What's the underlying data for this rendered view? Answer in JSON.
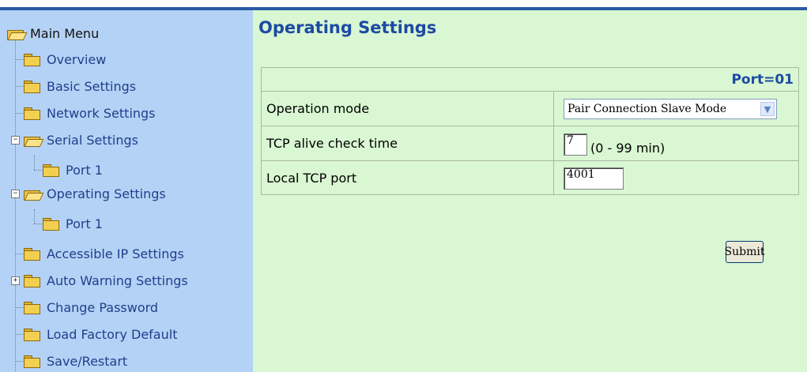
{
  "sidebar": {
    "root_label": "Main Menu",
    "items": [
      {
        "label": "Overview"
      },
      {
        "label": "Basic Settings"
      },
      {
        "label": "Network Settings"
      },
      {
        "label": "Serial Settings",
        "expander": "−"
      },
      {
        "label": "Port 1"
      },
      {
        "label": "Operating Settings",
        "expander": "−"
      },
      {
        "label": "Port 1"
      },
      {
        "label": "Accessible IP Settings"
      },
      {
        "label": "Auto Warning Settings",
        "expander": "+"
      },
      {
        "label": "Change Password"
      },
      {
        "label": "Load Factory Default"
      },
      {
        "label": "Save/Restart"
      }
    ]
  },
  "main": {
    "title": "Operating Settings",
    "port_label": "Port=01",
    "rows": [
      {
        "label": "Operation mode",
        "control": "select",
        "value": "Pair Connection Slave Mode"
      },
      {
        "label": "TCP alive check time",
        "control": "text",
        "value": "7",
        "hint": "(0 - 99 min)"
      },
      {
        "label": "Local TCP port",
        "control": "text",
        "value": "4001"
      }
    ],
    "submit_label": "Submit"
  },
  "colors": {
    "sidebar_bg": "#b4d2f5",
    "main_bg": "#d9f7d2",
    "title": "#1c4aa3",
    "top_rule": "#2a5aa8"
  }
}
